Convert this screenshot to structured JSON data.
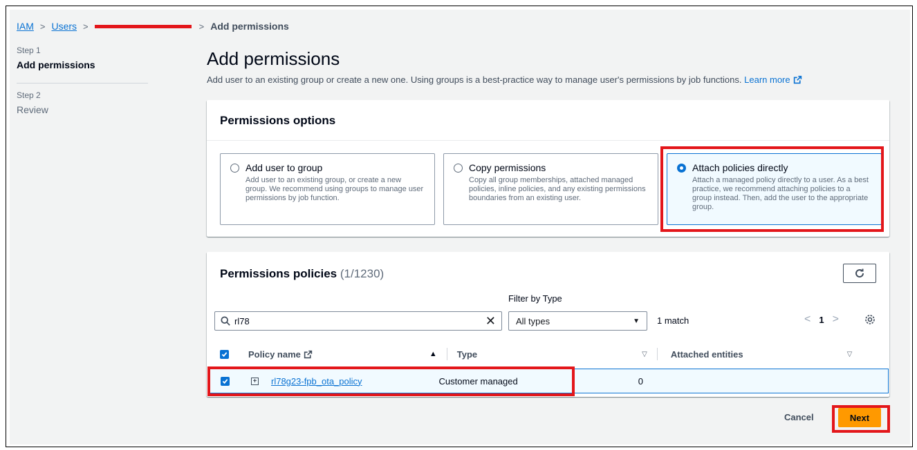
{
  "breadcrumb": {
    "iam": "IAM",
    "users": "Users",
    "current": "Add permissions"
  },
  "steps": [
    {
      "label": "Step 1",
      "title": "Add permissions"
    },
    {
      "label": "Step 2",
      "title": "Review"
    }
  ],
  "page": {
    "title": "Add permissions",
    "description": "Add user to an existing group or create a new one. Using groups is a best-practice way to manage user's permissions by job functions.",
    "learn_more": "Learn more"
  },
  "permissions_options": {
    "title": "Permissions options",
    "options": [
      {
        "title": "Add user to group",
        "description": "Add user to an existing group, or create a new group. We recommend using groups to manage user permissions by job function.",
        "selected": false
      },
      {
        "title": "Copy permissions",
        "description": "Copy all group memberships, attached managed policies, inline policies, and any existing permissions boundaries from an existing user.",
        "selected": false
      },
      {
        "title": "Attach policies directly",
        "description": "Attach a managed policy directly to a user. As a best practice, we recommend attaching policies to a group instead. Then, add the user to the appropriate group.",
        "selected": true
      }
    ]
  },
  "policies": {
    "title": "Permissions policies",
    "count": "(1/1230)",
    "filter_by_type_label": "Filter by Type",
    "search_value": "rl78",
    "type_select": "All types",
    "match_text": "1 match",
    "page": "1",
    "columns": [
      "Policy name",
      "Type",
      "Attached entities"
    ],
    "rows": [
      {
        "name": "rl78g23-fpb_ota_policy",
        "type": "Customer managed",
        "attached": "0",
        "checked": true
      }
    ]
  },
  "footer": {
    "cancel": "Cancel",
    "next": "Next"
  },
  "colors": {
    "accent": "#0972d3",
    "primary_button": "#ff9900",
    "highlight": "#e3161a"
  }
}
